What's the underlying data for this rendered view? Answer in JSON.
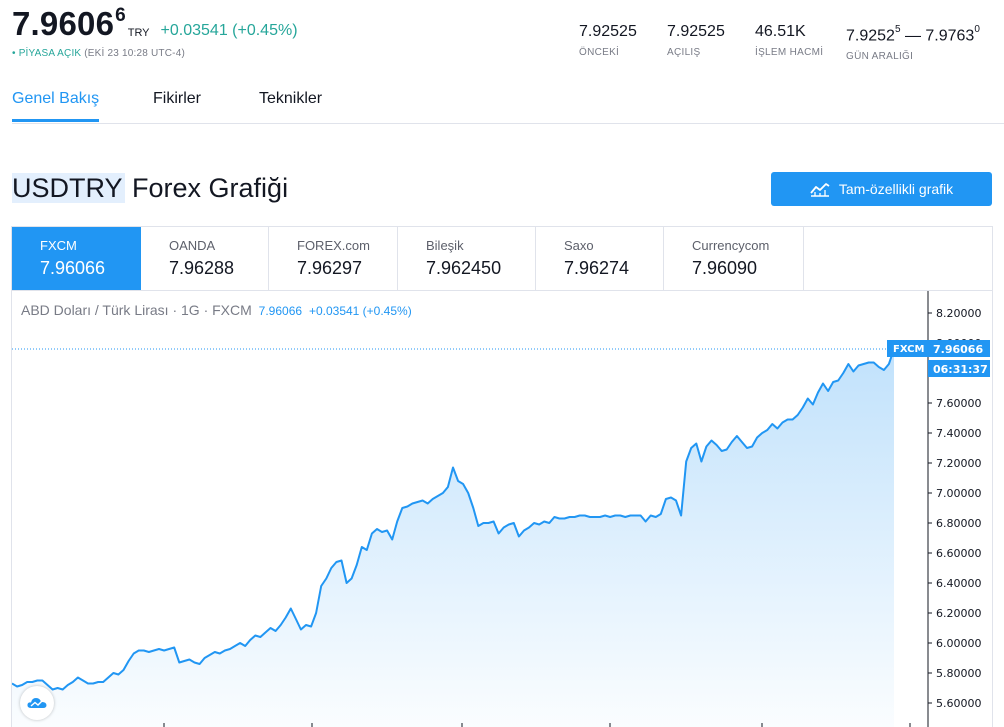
{
  "quote": {
    "price_main": "7.9606",
    "price_sup": "6",
    "currency": "TRY",
    "change": "+0.03541 (+0.45%)",
    "status_dot": "•",
    "status_open": "PİYASA AÇIK",
    "status_time": "(EKİ 23 10:28 UTC-4)"
  },
  "stats": [
    {
      "value": "7.92525",
      "label": "ÖNCEKİ"
    },
    {
      "value": "7.92525",
      "label": "AÇILIŞ"
    },
    {
      "value": "46.51K",
      "label": "İŞLEM HACMİ"
    },
    {
      "value_a": "7.9252",
      "sup_a": "5",
      "dash": " — ",
      "value_b": "7.9763",
      "sup_b": "0",
      "label": "GÜN ARALIĞI"
    }
  ],
  "tabs": [
    "Genel Bakış",
    "Fikirler",
    "Teknikler"
  ],
  "title": {
    "symbol": "USDTRY",
    "rest": " Forex Grafiği"
  },
  "full_chart_button": "Tam-özellikli grafik",
  "providers": [
    {
      "name": "FXCM",
      "value": "7.96066"
    },
    {
      "name": "OANDA",
      "value": "7.96288"
    },
    {
      "name": "FOREX.com",
      "value": "7.96297"
    },
    {
      "name": "Bileşik",
      "value": "7.962450"
    },
    {
      "name": "Saxo",
      "value": "7.96274"
    },
    {
      "name": "Currencycom",
      "value": "7.96090"
    }
  ],
  "legend": {
    "text": "ABD Doları / Türk Lirası · 1G · FXCM",
    "price": "7.96066",
    "change": "+0.03541 (+0.45%)"
  },
  "colors": {
    "accent": "#2196f3",
    "positive": "#26a69a"
  },
  "chart_data": {
    "type": "area",
    "series_label": "FXCM",
    "last_price": "7.96066",
    "countdown": "06:31:37",
    "y_ticks": [
      "8.20000",
      "8.00000",
      "7.80000",
      "7.60000",
      "7.40000",
      "7.20000",
      "7.00000",
      "6.80000",
      "6.60000",
      "6.40000",
      "6.20000",
      "6.00000",
      "5.80000",
      "5.60000"
    ],
    "ylim": [
      5.56,
      8.25
    ],
    "values": [
      5.73,
      5.71,
      5.72,
      5.74,
      5.74,
      5.75,
      5.75,
      5.72,
      5.69,
      5.7,
      5.69,
      5.72,
      5.74,
      5.77,
      5.75,
      5.73,
      5.73,
      5.74,
      5.74,
      5.77,
      5.8,
      5.79,
      5.82,
      5.88,
      5.93,
      5.95,
      5.95,
      5.94,
      5.95,
      5.96,
      5.95,
      5.96,
      5.97,
      5.87,
      5.88,
      5.89,
      5.87,
      5.86,
      5.9,
      5.92,
      5.94,
      5.93,
      5.95,
      5.96,
      5.98,
      6.0,
      5.98,
      6.02,
      6.05,
      6.04,
      6.07,
      6.1,
      6.08,
      6.12,
      6.17,
      6.23,
      6.16,
      6.09,
      6.12,
      6.11,
      6.2,
      6.38,
      6.43,
      6.5,
      6.54,
      6.55,
      6.4,
      6.43,
      6.52,
      6.64,
      6.62,
      6.73,
      6.76,
      6.74,
      6.75,
      6.69,
      6.81,
      6.9,
      6.91,
      6.93,
      6.94,
      6.95,
      6.93,
      6.96,
      6.98,
      7.0,
      7.04,
      7.17,
      7.08,
      7.06,
      7.0,
      6.9,
      6.78,
      6.8,
      6.8,
      6.81,
      6.73,
      6.77,
      6.79,
      6.8,
      6.71,
      6.75,
      6.77,
      6.8,
      6.79,
      6.81,
      6.8,
      6.84,
      6.83,
      6.83,
      6.84,
      6.84,
      6.85,
      6.85,
      6.84,
      6.84,
      6.84,
      6.85,
      6.84,
      6.85,
      6.85,
      6.84,
      6.85,
      6.85,
      6.85,
      6.81,
      6.85,
      6.84,
      6.86,
      6.96,
      6.97,
      6.95,
      6.85,
      7.21,
      7.3,
      7.33,
      7.21,
      7.31,
      7.35,
      7.32,
      7.28,
      7.29,
      7.34,
      7.38,
      7.34,
      7.3,
      7.31,
      7.37,
      7.4,
      7.42,
      7.46,
      7.43,
      7.47,
      7.49,
      7.49,
      7.52,
      7.57,
      7.63,
      7.59,
      7.67,
      7.73,
      7.68,
      7.74,
      7.75,
      7.8,
      7.86,
      7.81,
      7.85,
      7.86,
      7.87,
      7.87,
      7.84,
      7.82,
      7.86,
      7.96066
    ]
  }
}
